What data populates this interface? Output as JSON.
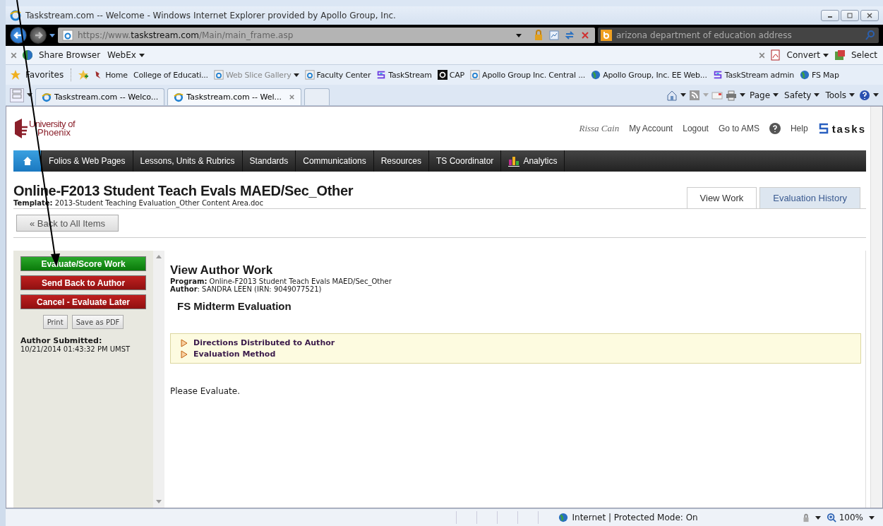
{
  "window": {
    "title": "Taskstream.com -- Welcome - Windows Internet Explorer provided by Apollo Group, Inc."
  },
  "address_bar": {
    "url": "https://www.**taskstream.com**/Main/main_frame.asp",
    "search": {
      "value": "arizona department of education address"
    }
  },
  "toolbar": {
    "items": [
      "Share Browser",
      "WebEx"
    ],
    "right_items": [
      "Convert",
      "Select"
    ]
  },
  "favorites": {
    "label": "Favorites",
    "links": [
      {
        "label": "Home",
        "kind": "bird",
        "disabled": false
      },
      {
        "label": "College of Educati...",
        "kind": "plain",
        "disabled": false
      },
      {
        "label": "Web Slice Gallery",
        "kind": "ie",
        "disabled": true
      },
      {
        "label": "Faculty Center",
        "kind": "ie",
        "disabled": false
      },
      {
        "label": "TaskStream",
        "kind": "ts",
        "disabled": false
      },
      {
        "label": "CAP",
        "kind": "cap",
        "disabled": false
      },
      {
        "label": "Apollo Group Inc. Central ...",
        "kind": "ie",
        "disabled": false
      },
      {
        "label": "Apollo Group, Inc. EE Web...",
        "kind": "globe",
        "disabled": false
      },
      {
        "label": "TaskStream admin",
        "kind": "ts",
        "disabled": false
      },
      {
        "label": "FS Map",
        "kind": "globe",
        "disabled": false
      }
    ]
  },
  "tabs": [
    {
      "label": "Taskstream.com -- Welco...",
      "selected": false
    },
    {
      "label": "Taskstream.com -- Wel...",
      "selected": true
    }
  ],
  "command_bar": [
    "Page",
    "Safety",
    "Tools"
  ],
  "page": {
    "logo": [
      "University of",
      "Phoenix"
    ],
    "user": "Rissa Cain",
    "links": [
      "My Account",
      "Logout",
      "Go to AMS",
      "Help"
    ],
    "brand": "tasks",
    "nav": [
      {
        "kind": "home",
        "selected": true
      },
      {
        "kind": "text",
        "label": "Folios & Web Pages",
        "selected": false
      },
      {
        "kind": "text",
        "label": "Lessons, Units & Rubrics",
        "selected": false
      },
      {
        "kind": "text",
        "label": "Standards",
        "selected": false
      },
      {
        "kind": "text",
        "label": "Communications",
        "selected": false
      },
      {
        "kind": "text",
        "label": "Resources",
        "selected": false
      },
      {
        "kind": "text",
        "label": "TS Coordinator",
        "selected": false
      },
      {
        "kind": "analytics",
        "label": "Analytics",
        "selected": false
      }
    ],
    "title": "Online-F2013 Student Teach Evals MAED/Sec_Other",
    "template": "**Template:** 2013-Student Teaching Evaluation_Other Content Area.doc",
    "back_button": "« Back to All Items",
    "view_tabs": [
      {
        "label": "View Work",
        "selected": true
      },
      {
        "label": "Evaluation History",
        "selected": false
      }
    ],
    "sidebar": {
      "buttons": [
        {
          "label": "Evaluate/Score Work",
          "kind": "primary"
        },
        {
          "label": "Send Back to Author",
          "kind": "danger"
        },
        {
          "label": "Cancel - Evaluate Later",
          "kind": "danger"
        }
      ],
      "small_buttons": [
        "Print",
        "Save as PDF"
      ],
      "submitted_label": "Author Submitted:",
      "submitted_value": "10/21/2014 01:43:32 PM UMST"
    },
    "content": {
      "heading": "View Author Work",
      "program": "**Program:** Online-F2013 Student Teach Evals MAED/Sec_Other",
      "author": "**Author**: SANDRA LEEN (IRN: 9049077521)",
      "section_title": "FS Midterm Evaluation",
      "expanders": [
        "Directions Distributed to Author",
        "Evaluation Method"
      ],
      "message": "Please Evaluate."
    }
  },
  "status_bar": {
    "zone": "Internet | Protected Mode: On",
    "zoom": "100%"
  }
}
